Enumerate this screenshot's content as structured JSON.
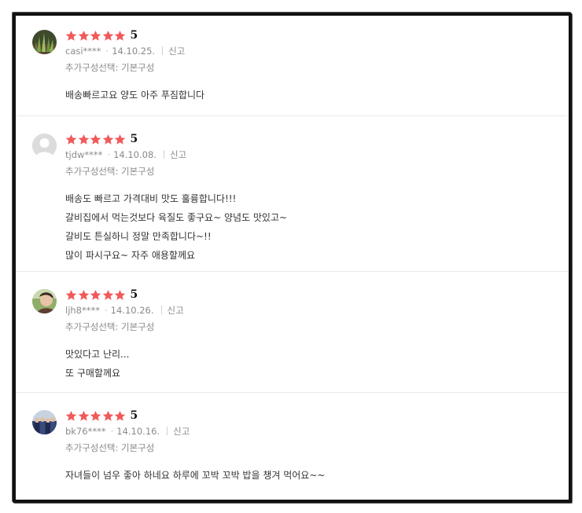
{
  "colors": {
    "star": "#f05a5a",
    "text": "#333333",
    "meta": "#8a8a8a",
    "border": "#111111"
  },
  "reviews": [
    {
      "avatar_icon": "plant-photo-avatar",
      "score": "5",
      "stars": 5,
      "user": "casi****",
      "date": "14.10.25.",
      "report": "신고",
      "option": "추가구성선택: 기본구성",
      "lines": [
        "배송빠르고요 양도 아주 푸짐합니다"
      ]
    },
    {
      "avatar_icon": "default-user-avatar",
      "score": "5",
      "stars": 5,
      "user": "tjdw****",
      "date": "14.10.08.",
      "report": "신고",
      "option": "추가구성선택: 기본구성",
      "lines": [
        "배송도 빠르고 가격대비 맛도 훌륭합니다!!!",
        "갈비집에서 먹는것보다 육질도 좋구요~ 양념도 맛있고~",
        "갈비도 튼실하니 정말 만족합니다~!!",
        "많이 파시구요~ 자주 애용할께요"
      ]
    },
    {
      "avatar_icon": "person-photo-avatar",
      "score": "5",
      "stars": 5,
      "user": "ljh8****",
      "date": "14.10.26.",
      "report": "신고",
      "option": "추가구성선택: 기본구성",
      "lines": [
        "맛있다고 난리...",
        "또 구매할께요"
      ]
    },
    {
      "avatar_icon": "group-photo-avatar",
      "score": "5",
      "stars": 5,
      "user": "bk76****",
      "date": "14.10.16.",
      "report": "신고",
      "option": "추가구성선택: 기본구성",
      "lines": [
        "자녀들이 넘우 좋아 하네요 하루에 꼬박 꼬박 밥을 챙겨 먹어요~~"
      ]
    }
  ]
}
